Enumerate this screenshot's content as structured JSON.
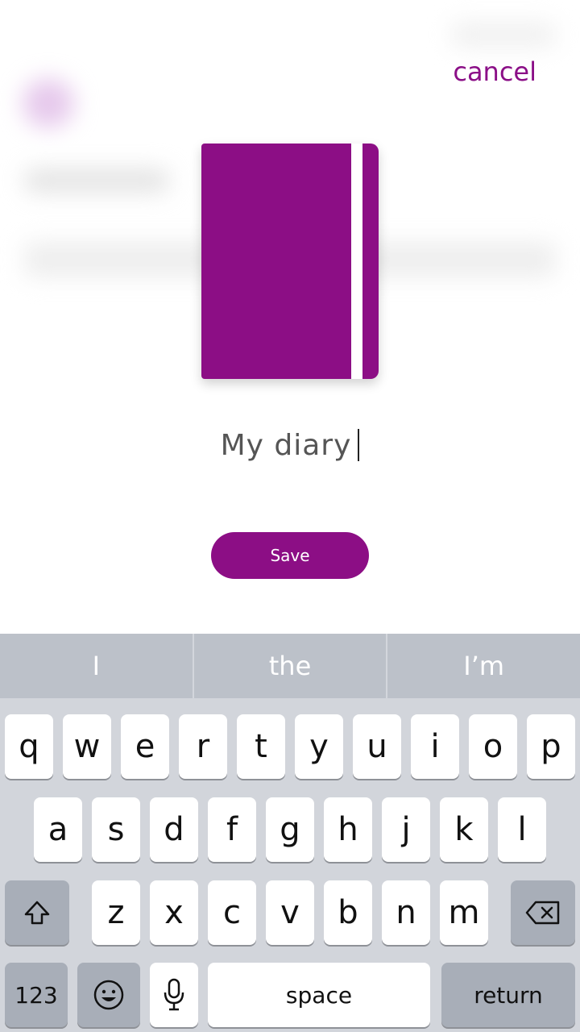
{
  "header": {
    "cancel_label": "cancel"
  },
  "notebook": {
    "color": "#8c0e85",
    "icon": "notebook-icon"
  },
  "title_field": {
    "value": "My diary"
  },
  "save_button": {
    "label": "Save"
  },
  "keyboard": {
    "suggestions": [
      "I",
      "the",
      "I’m"
    ],
    "row1": [
      "q",
      "w",
      "e",
      "r",
      "t",
      "y",
      "u",
      "i",
      "o",
      "p"
    ],
    "row2": [
      "a",
      "s",
      "d",
      "f",
      "g",
      "h",
      "j",
      "k",
      "l"
    ],
    "row3": [
      "z",
      "x",
      "c",
      "v",
      "b",
      "n",
      "m"
    ],
    "numbers_label": "123",
    "space_label": "space",
    "return_label": "return",
    "icons": {
      "shift": "shift-icon",
      "backspace": "backspace-icon",
      "emoji": "emoji-icon",
      "mic": "microphone-icon"
    }
  },
  "colors": {
    "accent": "#8c0e85",
    "keyboard_bg": "#d2d5db",
    "suggestion_bar": "#bcc1c9"
  }
}
